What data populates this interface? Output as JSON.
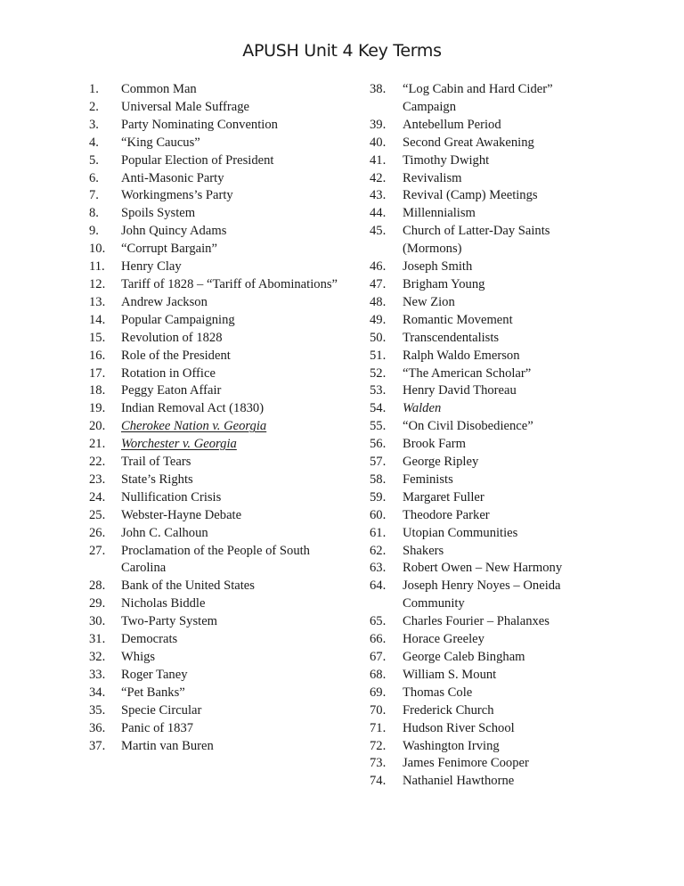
{
  "document": {
    "title": "APUSH Unit 4 Key Terms"
  },
  "columns": {
    "left": [
      {
        "num": "1.",
        "term": "Common Man"
      },
      {
        "num": "2.",
        "term": "Universal Male Suffrage"
      },
      {
        "num": "3.",
        "term": "Party Nominating Convention"
      },
      {
        "num": "4.",
        "term": "“King Caucus”"
      },
      {
        "num": "5.",
        "term": "Popular Election of President"
      },
      {
        "num": "6.",
        "term": "Anti-Masonic Party"
      },
      {
        "num": "7.",
        "term": "Workingmens’s Party"
      },
      {
        "num": "8.",
        "term": "Spoils System"
      },
      {
        "num": "9.",
        "term": "John Quincy Adams"
      },
      {
        "num": "10.",
        "term": "“Corrupt Bargain”"
      },
      {
        "num": "11.",
        "term": "Henry Clay"
      },
      {
        "num": "12.",
        "term": "Tariff of 1828 – “Tariff of Abominations”"
      },
      {
        "num": "13.",
        "term": "Andrew Jackson"
      },
      {
        "num": "14.",
        "term": "Popular Campaigning"
      },
      {
        "num": "15.",
        "term": "Revolution of 1828"
      },
      {
        "num": "16.",
        "term": "Role of the President"
      },
      {
        "num": "17.",
        "term": "Rotation in Office"
      },
      {
        "num": "18.",
        "term": "Peggy Eaton Affair"
      },
      {
        "num": "19.",
        "term": "Indian Removal Act (1830)"
      },
      {
        "num": "20.",
        "term": "Cherokee Nation v. Georgia",
        "style": "italic-underline"
      },
      {
        "num": "21.",
        "term": "Worchester v. Georgia",
        "style": "italic-underline"
      },
      {
        "num": "22.",
        "term": "Trail of Tears"
      },
      {
        "num": "23.",
        "term": "State’s Rights"
      },
      {
        "num": "24.",
        "term": "Nullification Crisis"
      },
      {
        "num": "25.",
        "term": "Webster-Hayne Debate"
      },
      {
        "num": "26.",
        "term": "John C. Calhoun"
      },
      {
        "num": "27.",
        "term": "Proclamation of the People of South Carolina"
      },
      {
        "num": "28.",
        "term": "Bank of the United States"
      },
      {
        "num": "29.",
        "term": "Nicholas Biddle"
      },
      {
        "num": "30.",
        "term": "Two-Party System"
      },
      {
        "num": "31.",
        "term": "Democrats"
      },
      {
        "num": "32.",
        "term": "Whigs"
      },
      {
        "num": "33.",
        "term": "Roger Taney"
      },
      {
        "num": "34.",
        "term": "“Pet Banks”"
      },
      {
        "num": "35.",
        "term": "Specie Circular"
      },
      {
        "num": "36.",
        "term": "Panic of 1837"
      },
      {
        "num": "37.",
        "term": "Martin van Buren"
      }
    ],
    "right": [
      {
        "num": "38.",
        "term": "“Log Cabin and Hard Cider” Campaign"
      },
      {
        "num": "39.",
        "term": "Antebellum Period"
      },
      {
        "num": "40.",
        "term": "Second Great Awakening"
      },
      {
        "num": "41.",
        "term": "Timothy Dwight"
      },
      {
        "num": "42.",
        "term": "Revivalism"
      },
      {
        "num": "43.",
        "term": "Revival (Camp) Meetings"
      },
      {
        "num": "44.",
        "term": "Millennialism"
      },
      {
        "num": "45.",
        "term": "Church of Latter-Day Saints (Mormons)"
      },
      {
        "num": "46.",
        "term": "Joseph Smith"
      },
      {
        "num": "47.",
        "term": "Brigham Young"
      },
      {
        "num": "48.",
        "term": "New Zion"
      },
      {
        "num": "49.",
        "term": "Romantic Movement"
      },
      {
        "num": "50.",
        "term": "Transcendentalists"
      },
      {
        "num": "51.",
        "term": "Ralph Waldo Emerson"
      },
      {
        "num": "52.",
        "term": "“The American Scholar”"
      },
      {
        "num": "53.",
        "term": "Henry David Thoreau"
      },
      {
        "num": "54.",
        "term": "Walden",
        "style": "italic"
      },
      {
        "num": "55.",
        "term": "“On Civil Disobedience”"
      },
      {
        "num": "56.",
        "term": "Brook Farm"
      },
      {
        "num": "57.",
        "term": "George Ripley"
      },
      {
        "num": "58.",
        "term": "Feminists"
      },
      {
        "num": "59.",
        "term": "Margaret Fuller"
      },
      {
        "num": "60.",
        "term": "Theodore Parker"
      },
      {
        "num": "61.",
        "term": "Utopian Communities"
      },
      {
        "num": "62.",
        "term": "Shakers"
      },
      {
        "num": "63.",
        "term": "Robert Owen – New Harmony"
      },
      {
        "num": "64.",
        "term": "Joseph Henry Noyes – Oneida Community"
      },
      {
        "num": "65.",
        "term": "Charles Fourier – Phalanxes"
      },
      {
        "num": "66.",
        "term": "Horace Greeley"
      },
      {
        "num": "67.",
        "term": "George Caleb Bingham"
      },
      {
        "num": "68.",
        "term": "William S.  Mount"
      },
      {
        "num": "69.",
        "term": "Thomas Cole"
      },
      {
        "num": "70.",
        "term": "Frederick Church"
      },
      {
        "num": "71.",
        "term": "Hudson River School"
      },
      {
        "num": "72.",
        "term": "Washington Irving"
      },
      {
        "num": "73.",
        "term": "James Fenimore Cooper"
      },
      {
        "num": "74.",
        "term": "Nathaniel Hawthorne"
      }
    ]
  }
}
